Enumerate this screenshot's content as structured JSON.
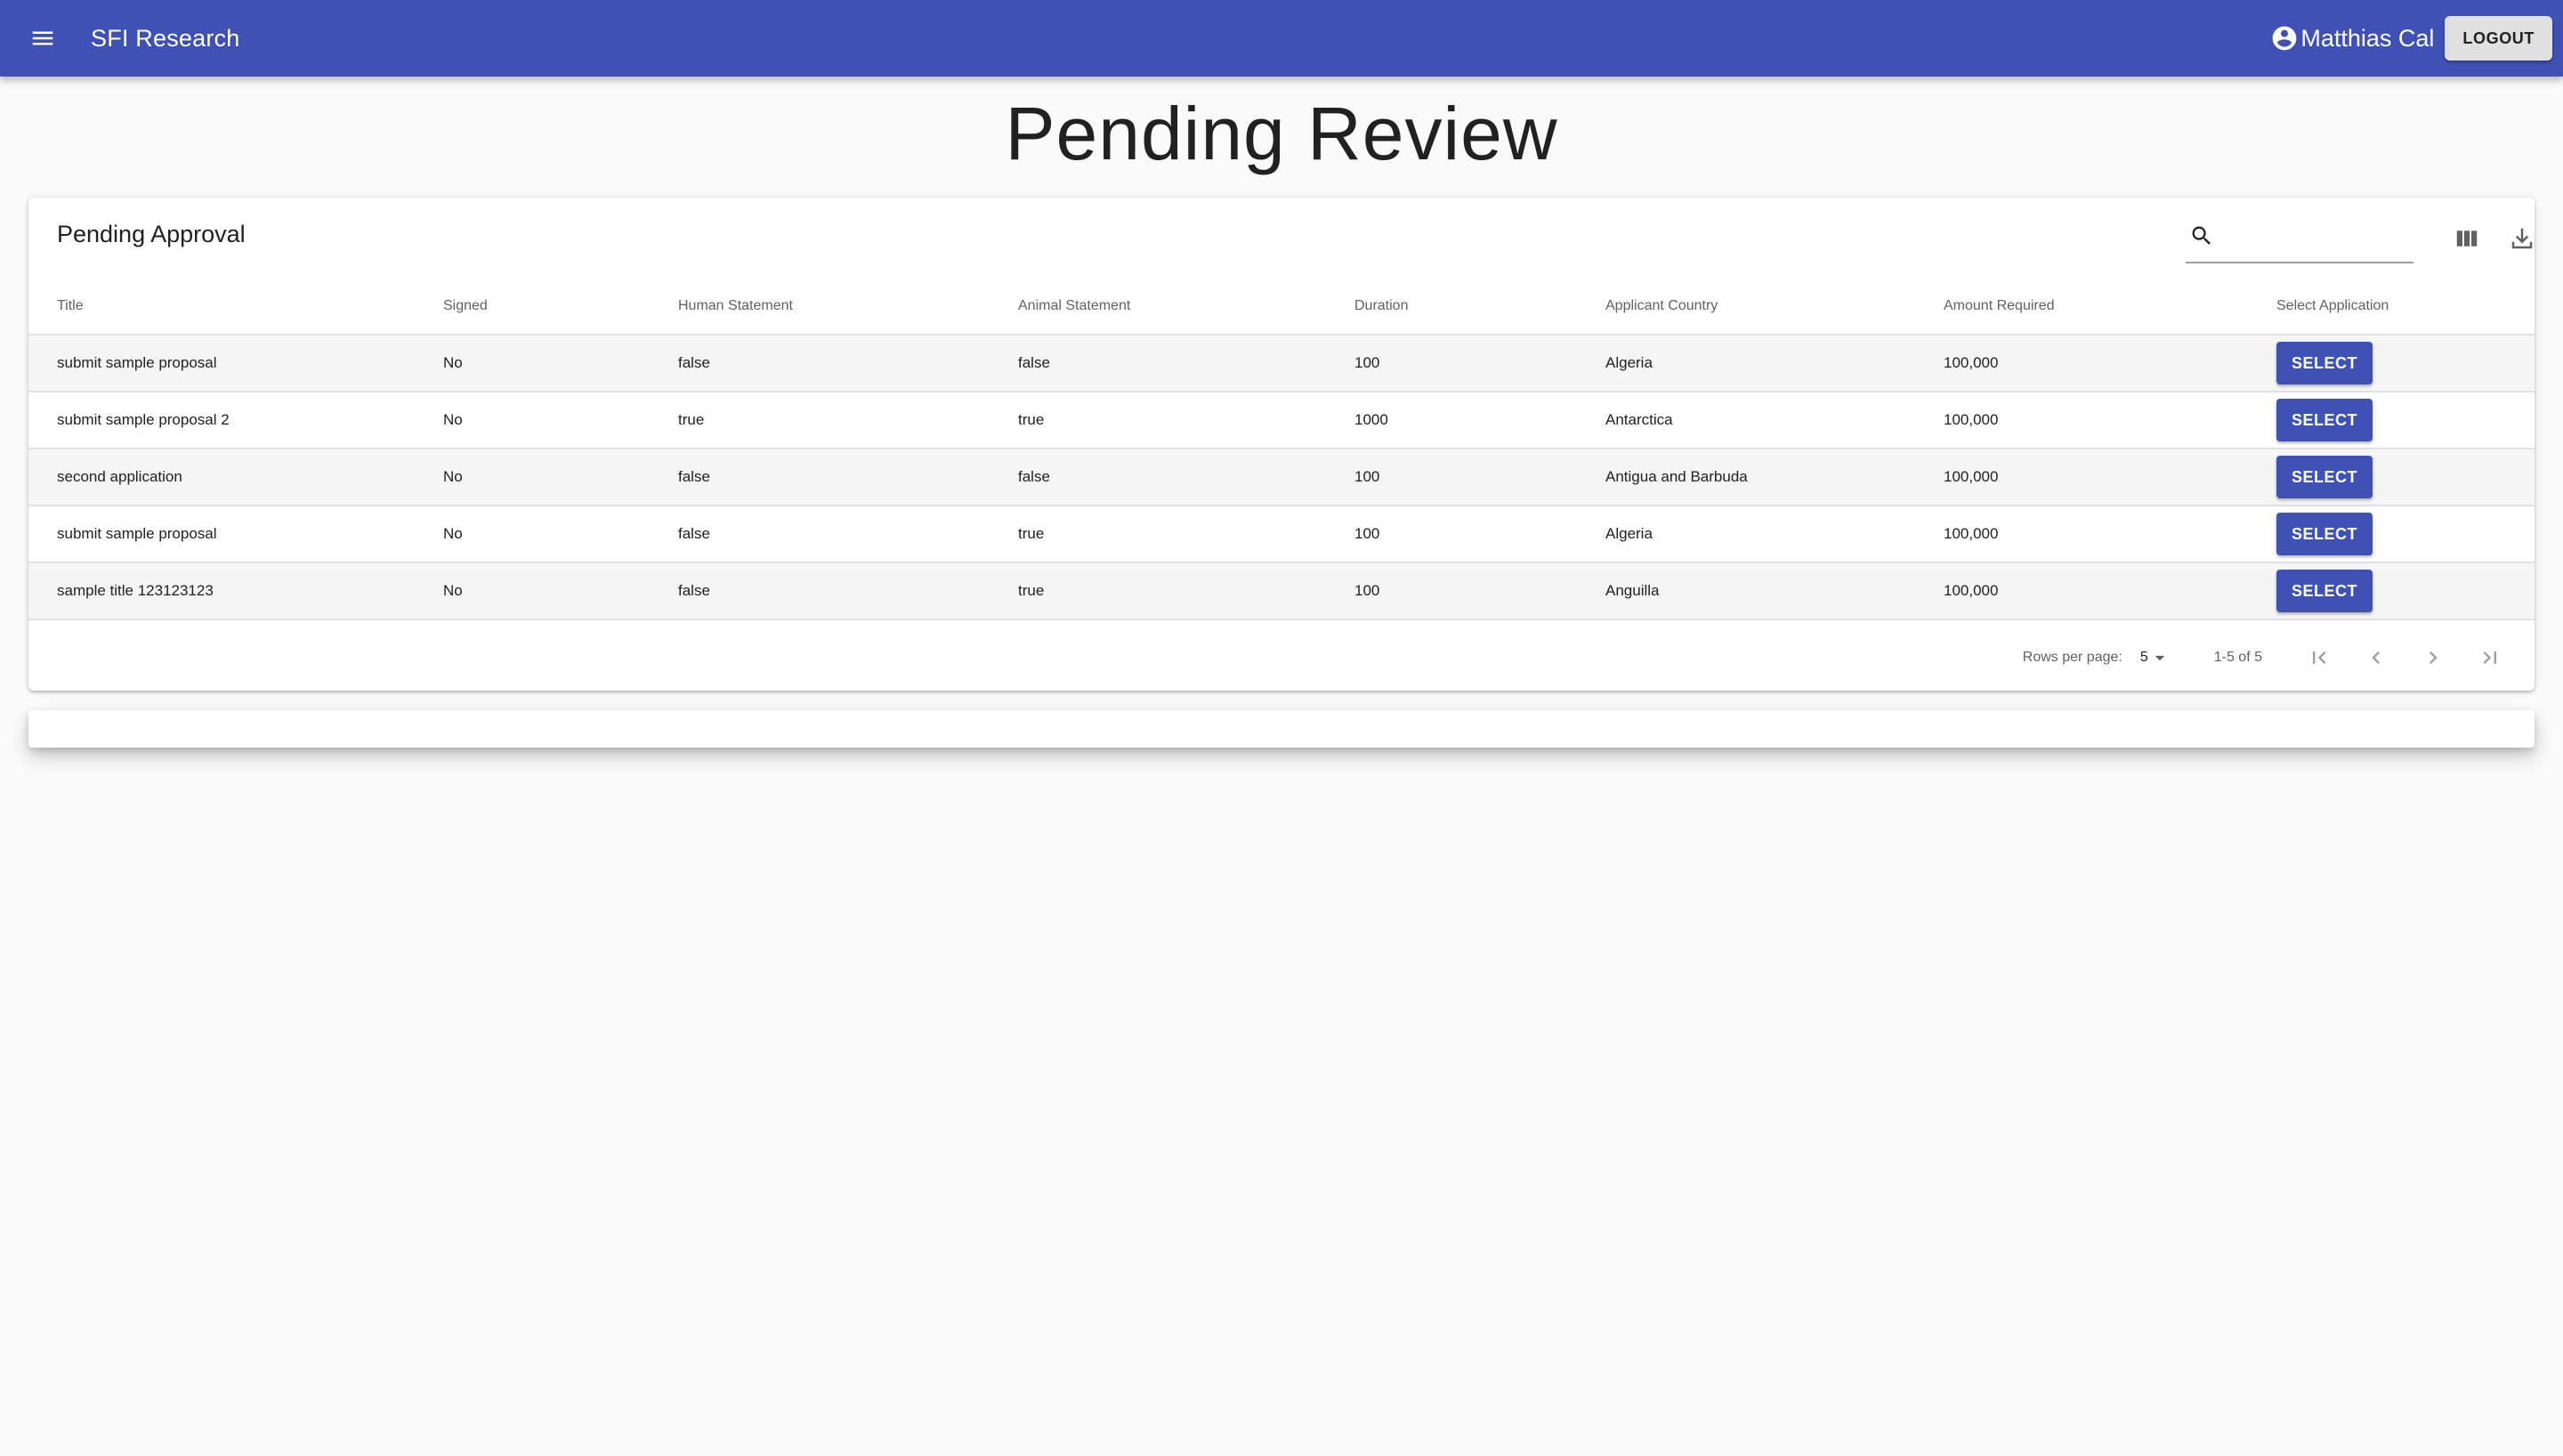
{
  "appbar": {
    "title": "SFI Research",
    "user_name": "Matthias Cal",
    "logout_label": "LOGOUT"
  },
  "page": {
    "title": "Pending Review"
  },
  "table": {
    "title": "Pending Approval",
    "search": {
      "value": "",
      "placeholder": ""
    },
    "columns": [
      "Title",
      "Signed",
      "Human Statement",
      "Animal Statement",
      "Duration",
      "Applicant Country",
      "Amount Required",
      "Select Application"
    ],
    "rows": [
      {
        "title": "submit sample proposal",
        "signed": "No",
        "human": "false",
        "animal": "false",
        "duration": "100",
        "country": "Algeria",
        "amount": "100,000",
        "action": "SELECT"
      },
      {
        "title": "submit sample proposal 2",
        "signed": "No",
        "human": "true",
        "animal": "true",
        "duration": "1000",
        "country": "Antarctica",
        "amount": "100,000",
        "action": "SELECT"
      },
      {
        "title": "second application",
        "signed": "No",
        "human": "false",
        "animal": "false",
        "duration": "100",
        "country": "Antigua and Barbuda",
        "amount": "100,000",
        "action": "SELECT"
      },
      {
        "title": "submit sample proposal",
        "signed": "No",
        "human": "false",
        "animal": "true",
        "duration": "100",
        "country": "Algeria",
        "amount": "100,000",
        "action": "SELECT"
      },
      {
        "title": "sample title 123123123",
        "signed": "No",
        "human": "false",
        "animal": "true",
        "duration": "100",
        "country": "Anguilla",
        "amount": "100,000",
        "action": "SELECT"
      }
    ],
    "pagination": {
      "rows_per_page_label": "Rows per page:",
      "rows_per_page": "5",
      "range": "1-5 of 5"
    }
  },
  "icons": {
    "menu": "menu-icon",
    "account": "account-circle-icon",
    "search": "search-icon",
    "columns": "view-column-icon",
    "download": "download-icon",
    "first_page": "first-page-icon",
    "prev_page": "chevron-left-icon",
    "next_page": "chevron-right-icon",
    "last_page": "last-page-icon"
  },
  "colors": {
    "primary": "#3f51b5",
    "background": "#fafafa",
    "stripe": "#f5f5f5"
  }
}
